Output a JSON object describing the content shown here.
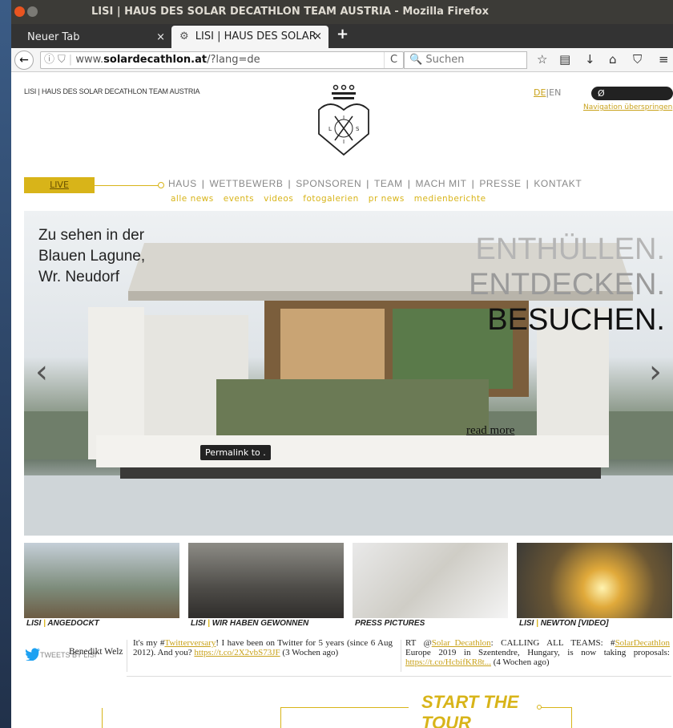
{
  "window": {
    "title": "LISI | HAUS DES SOLAR DECATHLON TEAM AUSTRIA - Mozilla Firefox"
  },
  "tabs": [
    {
      "label": "Neuer Tab",
      "close": "×"
    },
    {
      "label": "LISI | HAUS DES SOLAR",
      "close": "×"
    }
  ],
  "new_tab": "+",
  "urlbar": {
    "prefix": "www.",
    "domain": "solardecathlon.at",
    "path": "/?lang=de",
    "reload": "C"
  },
  "search": {
    "placeholder": "Suchen"
  },
  "site": {
    "title": "LISI | HAUS DES SOLAR DECATHLON TEAM AUSTRIA",
    "lang_de": "DE",
    "lang_sep": "|",
    "lang_en": "EN",
    "skip_nav": "Navigation überspringen",
    "search_icon": "Ø"
  },
  "logo": {
    "letters": [
      "L",
      "I",
      "S",
      "I"
    ]
  },
  "nav": {
    "live": "LIVE",
    "items": [
      "HAUS",
      "WETTBEWERB",
      "SPONSOREN",
      "TEAM",
      "MACH MIT",
      "PRESSE",
      "KONTAKT"
    ],
    "sub": [
      "alle news",
      "events",
      "videos",
      "fotogalerien",
      "pr news",
      "medienberichte"
    ]
  },
  "hero": {
    "caption_lines": [
      "Zu sehen in der",
      "Blauen Lagune,",
      "Wr. Neudorf"
    ],
    "headline": [
      "ENTHÜLLEN.",
      "ENTDECKEN.",
      "BESUCHEN."
    ],
    "read_more": "read more",
    "permalink": "Permalink to ."
  },
  "thumbs": [
    {
      "prefix": "LISI",
      "sep": " | ",
      "label": "ANGEDOCKT"
    },
    {
      "prefix": "LISI",
      "sep": " | ",
      "label": "WIR HABEN GEWONNEN"
    },
    {
      "prefix": "",
      "sep": "",
      "label": "PRESS PICTURES"
    },
    {
      "prefix": "LISI",
      "sep": " | ",
      "label": "NEWTON [VIDEO]"
    }
  ],
  "tweets": {
    "label": "TWEETS BY LISI",
    "t1": {
      "a": "It's my #",
      "link1": "Twitterversary",
      "b": "! I have been on Twitter for 5 years (since 6 Aug 2012). And you? ",
      "link2": "https://t.co/2X2vbS73JF",
      "c": " (3 Wochen ago)"
    },
    "t2": {
      "a": "RT @",
      "link1": "Solar_Decathlon",
      "b": ": CALLING ALL TEAMS: #",
      "link2": "SolarDecathlon",
      "c": " Europe 2019 in Szentendre, Hungary, is now taking proposals: ",
      "link3": "https://t.co/HcbifKR8t...",
      "d": " (4 Wochen ago)"
    }
  },
  "footer": {
    "name": "Benedikt Welz",
    "tour": [
      "START THE",
      "TOUR"
    ]
  },
  "colors": {
    "accent": "#d8b419",
    "titlebar": "#3c3b37"
  }
}
